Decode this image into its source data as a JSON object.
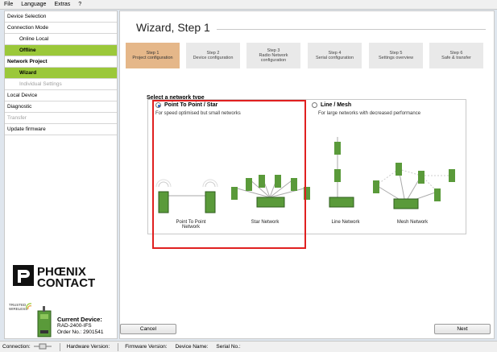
{
  "menu": [
    "File",
    "Language",
    "Extras",
    "?"
  ],
  "sidebar": {
    "items": [
      {
        "label": "Device Selection"
      },
      {
        "label": "Connection Mode"
      },
      {
        "label": "Online Local"
      },
      {
        "label": "Offline"
      },
      {
        "label": "Network Project"
      },
      {
        "label": "Wizard"
      },
      {
        "label": "Individual Settings"
      },
      {
        "label": "Local Device"
      },
      {
        "label": "Diagnostic"
      },
      {
        "label": "Transfer"
      },
      {
        "label": "Update firmware"
      }
    ],
    "logo_text": "PHŒNIX CONTACT",
    "trusted_text": "TRUSTED WIRELESS",
    "device": {
      "title": "Current Device:",
      "model": "RAD-2400-IFS",
      "order": "Order No.: 2901541"
    }
  },
  "main": {
    "title": "Wizard, Step 1",
    "steps": [
      {
        "line1": "Step 1",
        "line2": "Project configuration"
      },
      {
        "line1": "Step 2",
        "line2": "Device configuration"
      },
      {
        "line1": "Step 3",
        "line2": "Radio Network configuration"
      },
      {
        "line1": "Step 4",
        "line2": "Serial configuration"
      },
      {
        "line1": "Step 5",
        "line2": "Settings overview"
      },
      {
        "line1": "Step 6",
        "line2": "Safe & transfer"
      }
    ],
    "select_label": "Select a network type",
    "options": [
      {
        "label": "Point To Point / Star",
        "desc": "For speed optimised but small networks",
        "selected": true
      },
      {
        "label": "Line / Mesh",
        "desc": "For large networks with decreased performance",
        "selected": false
      }
    ],
    "network_labels": [
      "Point To Point Network",
      "Star Network",
      "Line Network",
      "Mesh Network"
    ],
    "cancel_label": "Cancel",
    "next_label": "Next"
  },
  "status": {
    "connection": "Connection:",
    "hardware": "Hardware Version:",
    "firmware": "Firmware Version:",
    "device_name": "Device Name:",
    "serial": "Serial No.:"
  },
  "colors": {
    "accent_green": "#9bc83a",
    "step_active": "#e5b789",
    "highlight": "#e02020"
  }
}
